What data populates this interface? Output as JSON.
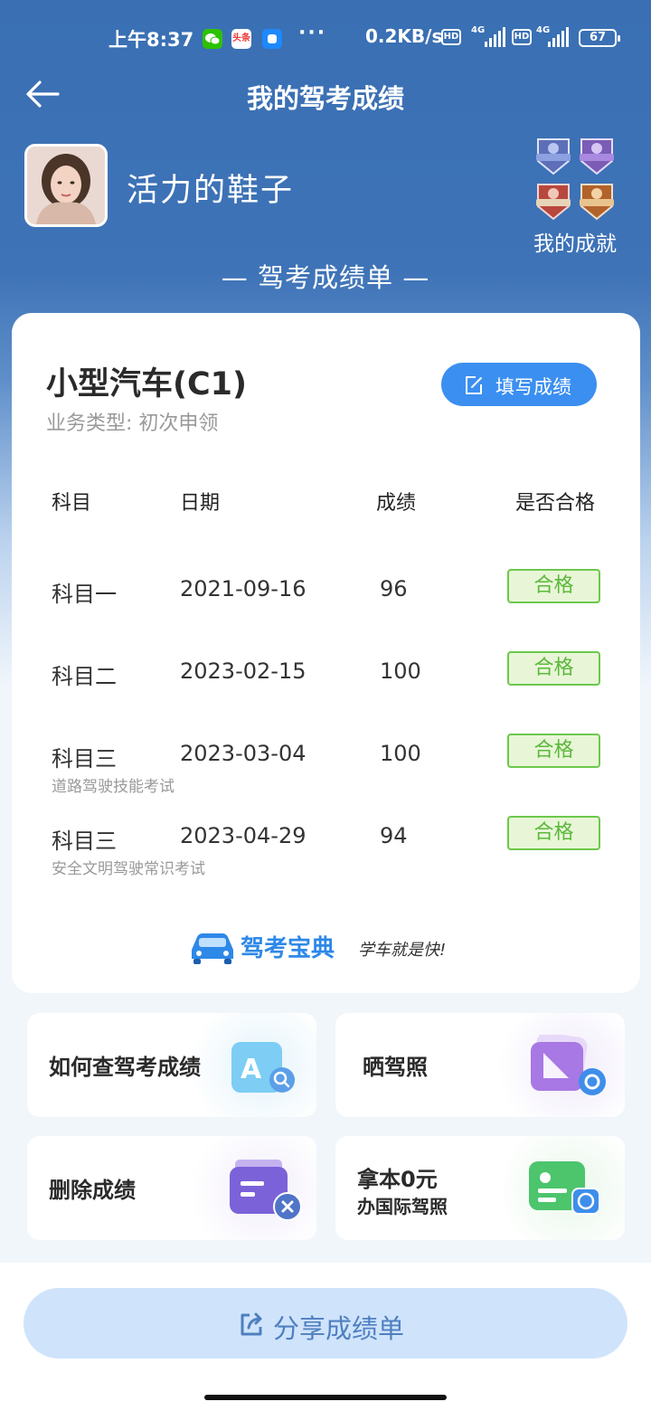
{
  "status_bar": {
    "time": "上午8:37",
    "toutiao_label": "头条",
    "more": "···",
    "net_speed": "0.2KB/s",
    "hd": "HD",
    "network": "4G",
    "battery": "67"
  },
  "header": {
    "title": "我的驾考成绩"
  },
  "profile": {
    "username": "活力的鞋子",
    "achievements_label": "我的成就"
  },
  "report_title": "— 驾考成绩单 —",
  "card": {
    "vehicle_type": "小型汽车(C1)",
    "business_type": "业务类型: 初次申领",
    "fill_button": "填写成绩",
    "columns": [
      "科目",
      "日期",
      "成绩",
      "是否合格"
    ],
    "rows": [
      {
        "subject": "科目一",
        "date": "2021-09-16",
        "score": "96",
        "status": "合格",
        "note": ""
      },
      {
        "subject": "科目二",
        "date": "2023-02-15",
        "score": "100",
        "status": "合格",
        "note": ""
      },
      {
        "subject": "科目三",
        "date": "2023-03-04",
        "score": "100",
        "status": "合格",
        "note": "道路驾驶技能考试"
      },
      {
        "subject": "科目三",
        "date": "2023-04-29",
        "score": "94",
        "status": "合格",
        "note": "安全文明驾驶常识考试"
      }
    ],
    "brand_name": "驾考宝典",
    "brand_slogan": "学车就是快!"
  },
  "actions": {
    "check_scores": "如何查驾考成绩",
    "show_license": "晒驾照",
    "delete_scores": "删除成绩",
    "intl_line1": "拿本0元",
    "intl_line2": "办国际驾照"
  },
  "share_button": "分享成绩单",
  "colors": {
    "header_blue": "#3a6fb3",
    "accent_blue": "#3b8ff0",
    "pass_green": "#5cb83c"
  }
}
